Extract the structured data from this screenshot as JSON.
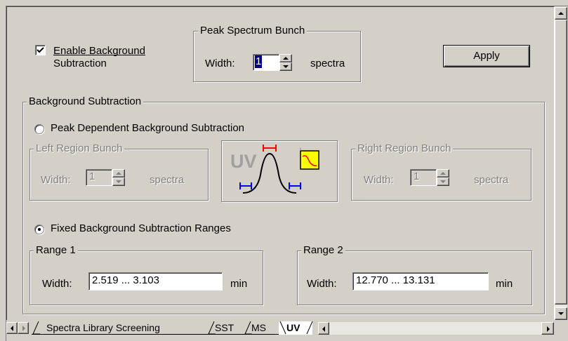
{
  "enable_background": {
    "label_line1": "Enable Background",
    "label_line2": "Subtraction",
    "checked": true
  },
  "peak_spectrum_bunch": {
    "title": "Peak Spectrum Bunch",
    "width_label": "Width:",
    "value": "1",
    "unit": "spectra"
  },
  "apply_button": {
    "label": "Apply"
  },
  "background_subtraction": {
    "title": "Background Subtraction",
    "peak_dependent": {
      "label": "Peak Dependent Background Subtraction",
      "selected": false,
      "left_region": {
        "title": "Left Region Bunch",
        "width_label": "Width:",
        "value": "1",
        "unit": "spectra"
      },
      "right_region": {
        "title": "Right Region Bunch",
        "width_label": "Width:",
        "value": "1",
        "unit": "spectra"
      },
      "illustration_text": "UV"
    },
    "fixed_ranges": {
      "label": "Fixed Background Subtraction Ranges",
      "selected": true,
      "range1": {
        "title": "Range 1",
        "width_label": "Width:",
        "value": "2.519 ... 3.103",
        "unit": "min"
      },
      "range2": {
        "title": "Range 2",
        "width_label": "Width:",
        "value": "12.770 ... 13.131",
        "unit": "min"
      }
    }
  },
  "tabs": [
    {
      "label": "Spectra Library Screening",
      "active": false
    },
    {
      "label": "SST",
      "active": false
    },
    {
      "label": "MS",
      "active": false
    },
    {
      "label": "UV",
      "active": true
    }
  ],
  "colors": {
    "face": "#d4d0c8",
    "shadow": "#808080",
    "highlight": "#ffffff",
    "uv_red": "#ff0000",
    "uv_blue": "#0000ff",
    "icon_yellow": "#ffff00"
  }
}
